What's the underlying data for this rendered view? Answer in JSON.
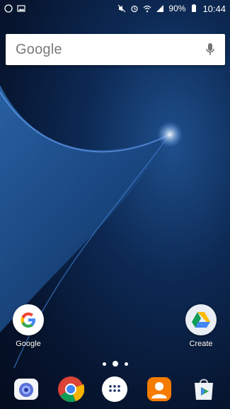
{
  "status_bar": {
    "time": "10:44",
    "battery": "90%",
    "left_icons": [
      "whatsapp-icon",
      "gallery-icon"
    ],
    "right_icons": [
      "mute-icon",
      "alarm-icon",
      "wifi-icon",
      "signal-icon",
      "battery-icon"
    ]
  },
  "search": {
    "logo_text": "Google"
  },
  "shortcuts": [
    {
      "label": "Google",
      "icon": "google-icon"
    },
    {
      "label": "Create",
      "icon": "drive-icon"
    }
  ],
  "page_indicator": {
    "pages": 3,
    "current_index": 1
  },
  "dock": [
    "camera-icon",
    "chrome-icon",
    "apps-drawer-icon",
    "contacts-icon",
    "play-store-icon"
  ]
}
